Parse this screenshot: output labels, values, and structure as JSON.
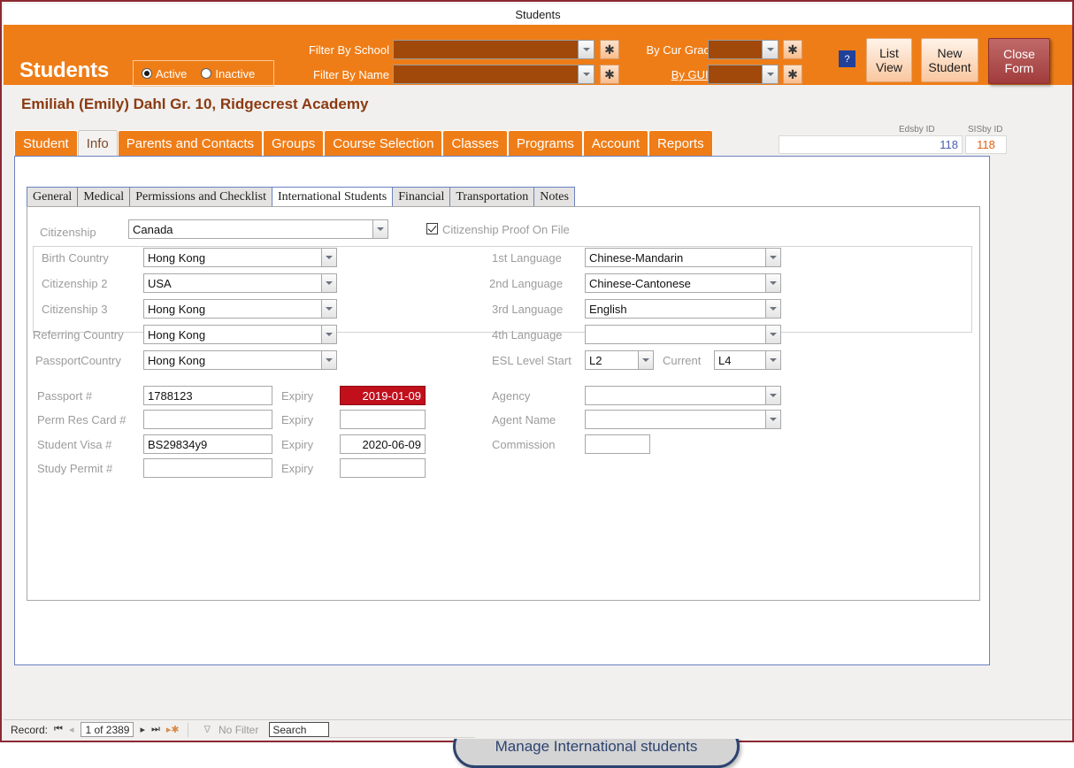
{
  "window": {
    "title": "Students"
  },
  "header": {
    "app_title": "Students",
    "status_filter": [
      {
        "label": "Active",
        "selected": true
      },
      {
        "label": "Inactive",
        "selected": false
      }
    ],
    "filters": [
      {
        "label": "Filter By School",
        "value": "",
        "underlined": false
      },
      {
        "label": "Filter By Name",
        "value": "",
        "underlined": false
      },
      {
        "label": "By Cur Grade",
        "value": "",
        "underlined": false
      },
      {
        "label": "By GUID",
        "value": "",
        "underlined": true
      }
    ],
    "star_button_label": "✱",
    "help_button_label": "?",
    "buttons": [
      {
        "line1": "List",
        "line2": "View"
      },
      {
        "line1": "New",
        "line2": "Student"
      },
      {
        "line1": "Close",
        "line2": "Form"
      }
    ]
  },
  "student": {
    "name_line": "Emiliah (Emily)  Dahl  Gr. 10, Ridgecrest Academy",
    "edsby_id_label": "Edsby ID",
    "edsby_id_value": "118",
    "sisby_id_label": "SISby ID",
    "sisby_id_value": "118"
  },
  "main_tabs": [
    {
      "label": "Student",
      "active": false
    },
    {
      "label": "Info",
      "active": true
    },
    {
      "label": "Parents and Contacts",
      "active": false
    },
    {
      "label": "Groups",
      "active": false
    },
    {
      "label": "Course Selection",
      "active": false
    },
    {
      "label": "Classes",
      "active": false
    },
    {
      "label": "Programs",
      "active": false
    },
    {
      "label": "Account",
      "active": false
    },
    {
      "label": "Reports",
      "active": false
    }
  ],
  "sub_tabs": [
    {
      "label": "General",
      "active": false
    },
    {
      "label": "Medical",
      "active": false
    },
    {
      "label": "Permissions and Checklist",
      "active": false
    },
    {
      "label": "International Students",
      "active": true
    },
    {
      "label": "Financial",
      "active": false
    },
    {
      "label": "Transportation",
      "active": false
    },
    {
      "label": "Notes",
      "active": false
    }
  ],
  "form": {
    "citizenship_label": "Citizenship",
    "citizenship_value": "Canada",
    "citizenship_proof_label": "Citizenship Proof On File",
    "citizenship_proof_checked": true,
    "left_combos": [
      {
        "label": "Birth Country",
        "value": "Hong Kong"
      },
      {
        "label": "Citizenship 2",
        "value": "USA"
      },
      {
        "label": "Citizenship 3",
        "value": "Hong Kong"
      },
      {
        "label": "Referring Country",
        "value": "Hong Kong"
      },
      {
        "label": "PassportCountry",
        "value": "Hong Kong"
      }
    ],
    "documents": [
      {
        "label": "Passport #",
        "value": "1788123",
        "expiry_label": "Expiry",
        "expiry_value": "2019-01-09",
        "expired": true
      },
      {
        "label": "Perm Res Card #",
        "value": "",
        "expiry_label": "Expiry",
        "expiry_value": "",
        "expired": false
      },
      {
        "label": "Student Visa #",
        "value": "BS29834y9",
        "expiry_label": "Expiry",
        "expiry_value": "2020-06-09",
        "expired": false
      },
      {
        "label": "Study Permit #",
        "value": "",
        "expiry_label": "Expiry",
        "expiry_value": "",
        "expired": false
      }
    ],
    "languages": [
      {
        "label": "1st Language",
        "value": "Chinese-Mandarin"
      },
      {
        "label": "2nd Language",
        "value": "Chinese-Cantonese"
      },
      {
        "label": "3rd Language",
        "value": "English"
      },
      {
        "label": "4th Language",
        "value": ""
      }
    ],
    "esl": {
      "start_label": "ESL Level Start",
      "start_value": "L2",
      "current_label": "Current",
      "current_value": "L4"
    },
    "agency": [
      {
        "label": "Agency",
        "value": "",
        "type": "combo"
      },
      {
        "label": "Agent Name",
        "value": "",
        "type": "combo"
      },
      {
        "label": "Commission",
        "value": "",
        "type": "text"
      }
    ],
    "manage_button_label": "Manage International students"
  },
  "statusbar": {
    "record_label": "Record:",
    "first_icon": "⏮",
    "prev_icon": "◂",
    "record_value": "1 of 2389",
    "next_icon": "▸",
    "last_icon": "⏭",
    "new_icon": "▸✱",
    "filter_icon": "∇",
    "filter_status": "No Filter",
    "search_value": "Search"
  }
}
